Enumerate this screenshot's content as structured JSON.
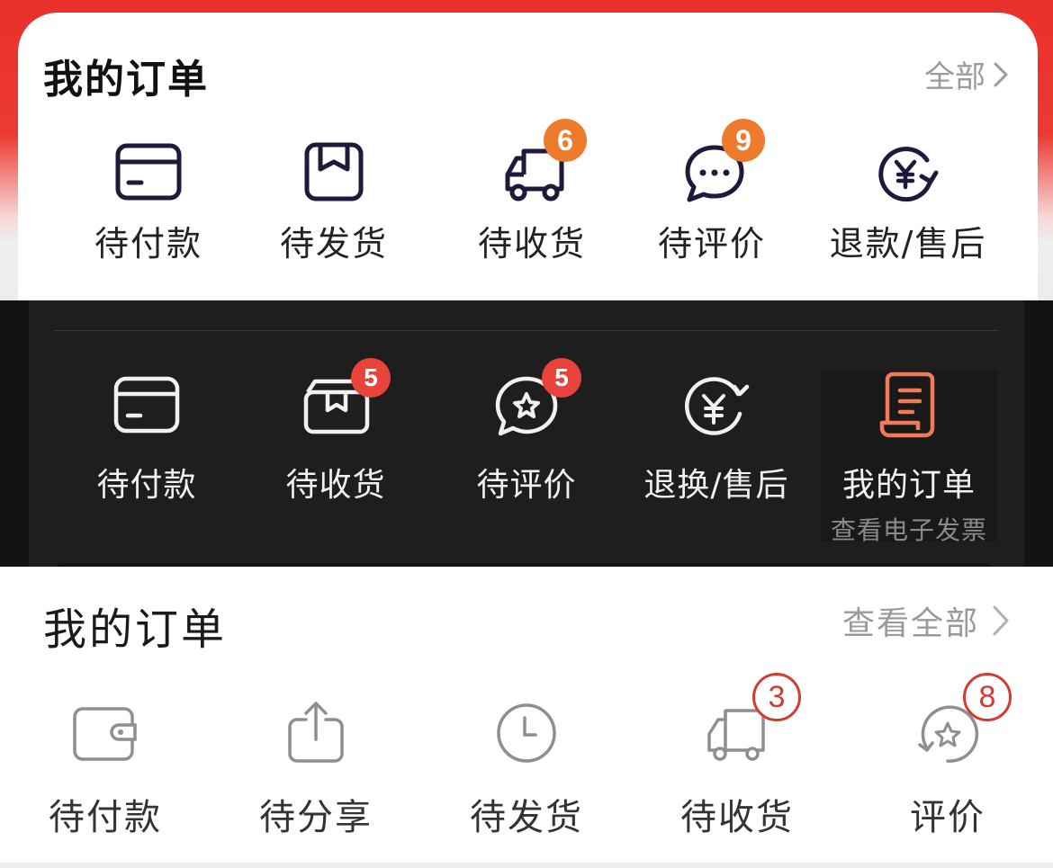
{
  "section1": {
    "title": "我的订单",
    "view_all": "全部",
    "items": [
      {
        "label": "待付款",
        "icon": "card-icon",
        "badge": ""
      },
      {
        "label": "待发货",
        "icon": "package-icon",
        "badge": ""
      },
      {
        "label": "待收货",
        "icon": "truck-icon",
        "badge": "6"
      },
      {
        "label": "待评价",
        "icon": "chat-bubble-icon",
        "badge": "9"
      },
      {
        "label": "退款/售后",
        "icon": "yen-refund-icon",
        "badge": ""
      }
    ],
    "colors": {
      "header_red": "#e8302a",
      "badge": "#ee7a2c",
      "icon": "#1e1a3a"
    }
  },
  "section2": {
    "items": [
      {
        "label": "待付款",
        "icon": "card-icon",
        "badge": ""
      },
      {
        "label": "待收货",
        "icon": "package-icon",
        "badge": "5"
      },
      {
        "label": "待评价",
        "icon": "star-bubble-icon",
        "badge": "5"
      },
      {
        "label": "退换/售后",
        "icon": "yen-refund-icon",
        "badge": ""
      },
      {
        "label": "我的订单",
        "sublabel": "查看电子发票",
        "icon": "receipt-icon",
        "badge": ""
      }
    ],
    "colors": {
      "background": "#1f1e1f",
      "badge": "#e8443b",
      "accent": "#f07a5a"
    }
  },
  "section3": {
    "title": "我的订单",
    "view_all": "查看全部",
    "items": [
      {
        "label": "待付款",
        "icon": "wallet-icon",
        "badge": ""
      },
      {
        "label": "待分享",
        "icon": "share-icon",
        "badge": ""
      },
      {
        "label": "待发货",
        "icon": "clock-icon",
        "badge": ""
      },
      {
        "label": "待收货",
        "icon": "truck-icon",
        "badge": "3"
      },
      {
        "label": "评价",
        "icon": "star-refresh-icon",
        "badge": "8"
      }
    ],
    "colors": {
      "badge_ring": "#d23b33",
      "icon": "#8f8f8f"
    }
  }
}
